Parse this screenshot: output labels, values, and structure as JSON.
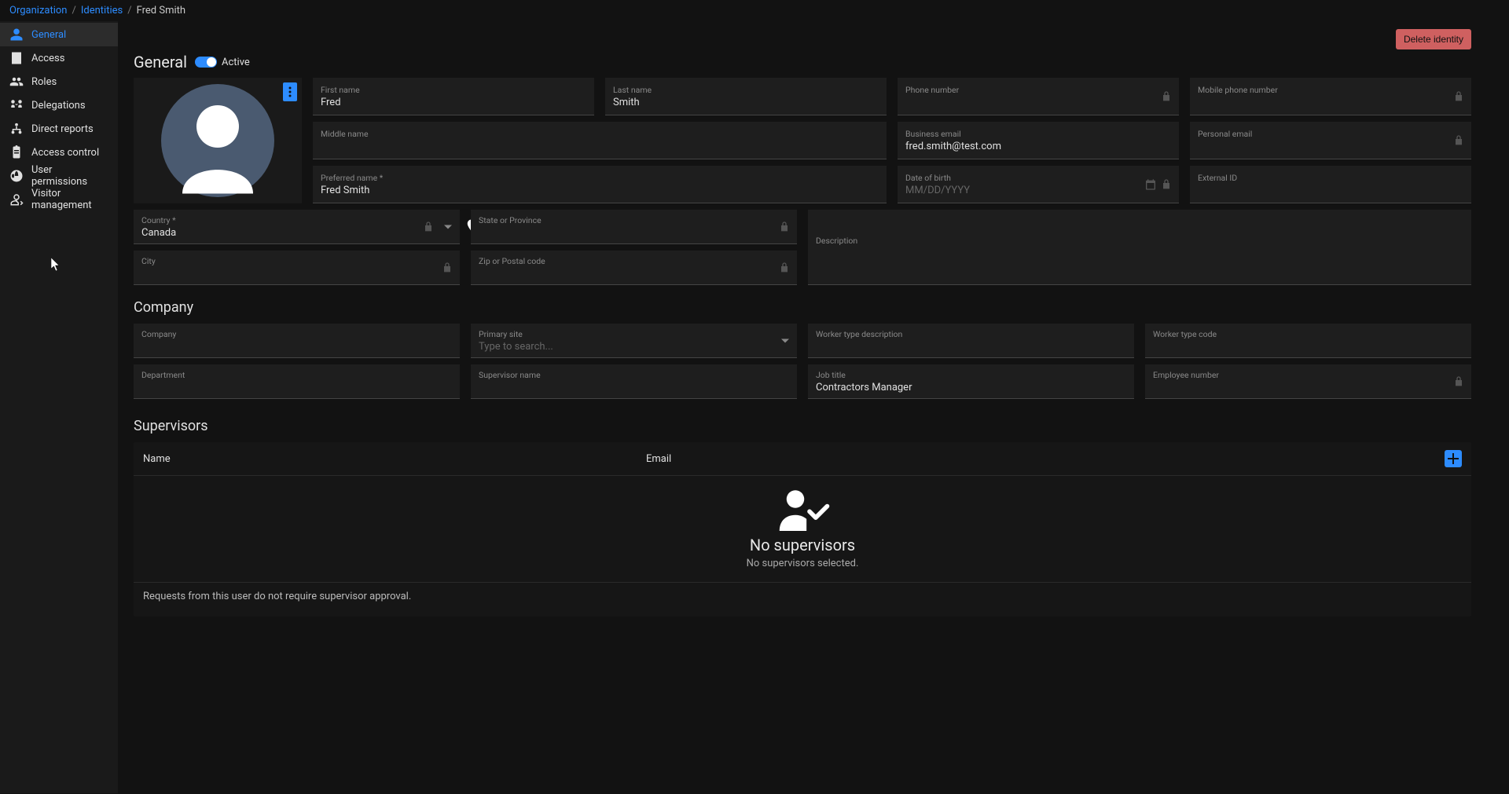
{
  "breadcrumb": {
    "org": "Organization",
    "identities": "Identities",
    "current": "Fred Smith"
  },
  "sidebar": {
    "items": [
      {
        "label": "General",
        "icon": "person-icon",
        "active": true
      },
      {
        "label": "Access",
        "icon": "badge-icon"
      },
      {
        "label": "Roles",
        "icon": "group-icon"
      },
      {
        "label": "Delegations",
        "icon": "delegation-icon"
      },
      {
        "label": "Direct reports",
        "icon": "hierarchy-icon"
      },
      {
        "label": "Access control",
        "icon": "clipboard-icon"
      },
      {
        "label": "User permissions",
        "icon": "globe-icon"
      },
      {
        "label": "Visitor management",
        "icon": "visitor-icon"
      }
    ]
  },
  "header": {
    "delete_label": "Delete identity"
  },
  "general": {
    "title": "General",
    "active_label": "Active",
    "fields": {
      "first_name": {
        "label": "First name",
        "value": "Fred"
      },
      "last_name": {
        "label": "Last name",
        "value": "Smith"
      },
      "phone": {
        "label": "Phone number",
        "value": "",
        "locked": true
      },
      "mobile_phone": {
        "label": "Mobile phone number",
        "value": "",
        "locked": true
      },
      "middle_name": {
        "label": "Middle name",
        "value": ""
      },
      "business_email": {
        "label": "Business email",
        "value": "fred.smith@test.com"
      },
      "personal_email": {
        "label": "Personal email",
        "value": "",
        "locked": true
      },
      "preferred_name": {
        "label": "Preferred name *",
        "value": "Fred Smith"
      },
      "dob": {
        "label": "Date of birth",
        "value": "",
        "placeholder": "MM/DD/YYYY",
        "locked": true
      },
      "external_id": {
        "label": "External ID",
        "value": ""
      },
      "country": {
        "label": "Country *",
        "value": "Canada",
        "locked": true
      },
      "state": {
        "label": "State or Province",
        "value": "",
        "locked": true
      },
      "description": {
        "label": "Description",
        "value": ""
      },
      "city": {
        "label": "City",
        "value": "",
        "locked": true
      },
      "zip": {
        "label": "Zip or Postal code",
        "value": "",
        "locked": true
      }
    }
  },
  "company": {
    "title": "Company",
    "fields": {
      "company": {
        "label": "Company",
        "value": ""
      },
      "primary_site": {
        "label": "Primary site",
        "value": "",
        "placeholder": "Type to search..."
      },
      "worker_type_desc": {
        "label": "Worker type description",
        "value": ""
      },
      "worker_type_code": {
        "label": "Worker type code",
        "value": ""
      },
      "department": {
        "label": "Department",
        "value": ""
      },
      "supervisor_name": {
        "label": "Supervisor name",
        "value": ""
      },
      "job_title": {
        "label": "Job title",
        "value": "Contractors Manager"
      },
      "employee_number": {
        "label": "Employee number",
        "value": "",
        "locked": true
      }
    }
  },
  "supervisors": {
    "title": "Supervisors",
    "columns": {
      "name": "Name",
      "email": "Email"
    },
    "empty_title": "No supervisors",
    "empty_sub": "No supervisors selected.",
    "footer_note": "Requests from this user do not require supervisor approval."
  }
}
